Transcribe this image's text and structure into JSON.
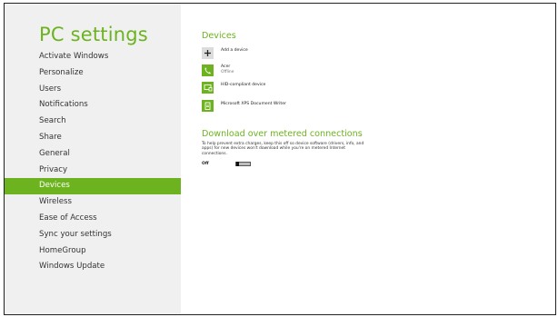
{
  "sidebar": {
    "title": "PC settings",
    "items": [
      {
        "label": "Activate Windows"
      },
      {
        "label": "Personalize"
      },
      {
        "label": "Users"
      },
      {
        "label": "Notifications"
      },
      {
        "label": "Search"
      },
      {
        "label": "Share"
      },
      {
        "label": "General"
      },
      {
        "label": "Privacy"
      },
      {
        "label": "Devices",
        "selected": true
      },
      {
        "label": "Wireless"
      },
      {
        "label": "Ease of Access"
      },
      {
        "label": "Sync your settings"
      },
      {
        "label": "HomeGroup"
      },
      {
        "label": "Windows Update"
      }
    ]
  },
  "devices": {
    "section_title": "Devices",
    "add_label": "Add a device",
    "items": [
      {
        "name": "Acer",
        "status": "Offline",
        "icon": "phone-icon"
      },
      {
        "name": "HID-compliant device",
        "status": "",
        "icon": "keyboard-device-icon"
      },
      {
        "name": "Microsoft XPS Document Writer",
        "status": "",
        "icon": "printer-document-icon"
      }
    ]
  },
  "metered": {
    "section_title": "Download over metered connections",
    "description": "To help prevent extra charges, keep this off so device software (drivers, info, and apps) for new devices won't download while you're on metered Internet connections.",
    "toggle_state_label": "Off",
    "toggle_on": false
  },
  "colors": {
    "accent": "#6cb31f",
    "sidebar_bg": "#f0f0f0"
  }
}
